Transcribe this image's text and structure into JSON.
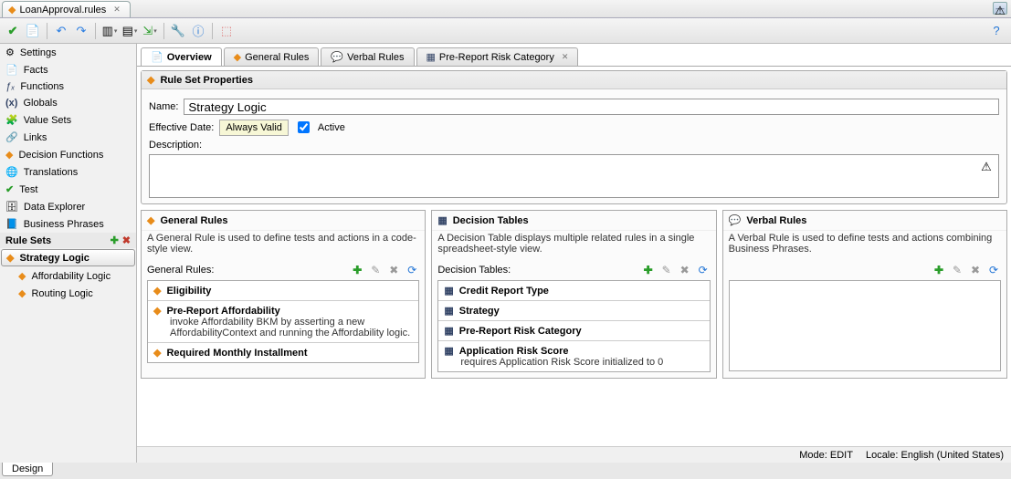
{
  "file_tab": {
    "title": "LoanApproval.rules"
  },
  "toolbar_icons": [
    "check",
    "doc",
    "undo",
    "redo",
    "cut",
    "copy",
    "paste",
    "wrench",
    "info",
    "link"
  ],
  "sidebar": {
    "items": [
      {
        "icon": "⚙",
        "label": "Settings"
      },
      {
        "icon": "📄",
        "label": "Facts"
      },
      {
        "icon": "ƒₓ",
        "label": "Functions"
      },
      {
        "icon": "(x)",
        "label": "Globals"
      },
      {
        "icon": "📊",
        "label": "Value Sets"
      },
      {
        "icon": "🔗",
        "label": "Links"
      },
      {
        "icon": "◆",
        "label": "Decision Functions"
      },
      {
        "icon": "🌐",
        "label": "Translations"
      },
      {
        "icon": "✔",
        "label": "Test"
      },
      {
        "icon": "🗄",
        "label": "Data Explorer"
      },
      {
        "icon": "📘",
        "label": "Business Phrases"
      }
    ],
    "rule_sets_header": "Rule Sets",
    "rule_sets": [
      {
        "label": "Strategy Logic",
        "selected": true
      },
      {
        "label": "Affordability Logic",
        "selected": false
      },
      {
        "label": "Routing Logic",
        "selected": false
      }
    ]
  },
  "tabs": [
    {
      "icon": "📄",
      "label": "Overview",
      "active": true,
      "closable": false
    },
    {
      "icon": "◆",
      "label": "General Rules",
      "active": false,
      "closable": false
    },
    {
      "icon": "💬",
      "label": "Verbal Rules",
      "active": false,
      "closable": false
    },
    {
      "icon": "▦",
      "label": "Pre-Report Risk Category",
      "active": false,
      "closable": true
    }
  ],
  "props_panel": {
    "title": "Rule Set Properties",
    "name_label": "Name:",
    "name_value": "Strategy Logic",
    "eff_label": "Effective Date:",
    "eff_value": "Always Valid",
    "active_label": "Active",
    "desc_label": "Description:"
  },
  "general_rules": {
    "title": "General Rules",
    "desc": "A General Rule is used to define tests and actions in a code-style view.",
    "list_label": "General Rules:",
    "items": [
      {
        "title": "Eligibility",
        "detail": ""
      },
      {
        "title": "Pre-Report Affordability",
        "detail": "invoke Affordability BKM by asserting a new AffordabilityContext and running the Affordability logic."
      },
      {
        "title": "Required Monthly Installment",
        "detail": ""
      }
    ]
  },
  "decision_tables": {
    "title": "Decision Tables",
    "desc": "A Decision Table displays multiple related rules in a single spreadsheet-style view.",
    "list_label": "Decision Tables:",
    "items": [
      {
        "title": "Credit Report Type",
        "detail": ""
      },
      {
        "title": "Strategy",
        "detail": ""
      },
      {
        "title": "Pre-Report Risk Category",
        "detail": ""
      },
      {
        "title": "Application Risk Score",
        "detail": "requires Application Risk Score initialized to 0"
      }
    ]
  },
  "verbal_rules": {
    "title": "Verbal Rules",
    "desc": "A Verbal Rule is used to define tests and actions combining Business Phrases."
  },
  "status": {
    "mode_label": "Mode:",
    "mode_value": "EDIT",
    "locale_label": "Locale:",
    "locale_value": "English (United States)"
  },
  "design_tab": "Design"
}
